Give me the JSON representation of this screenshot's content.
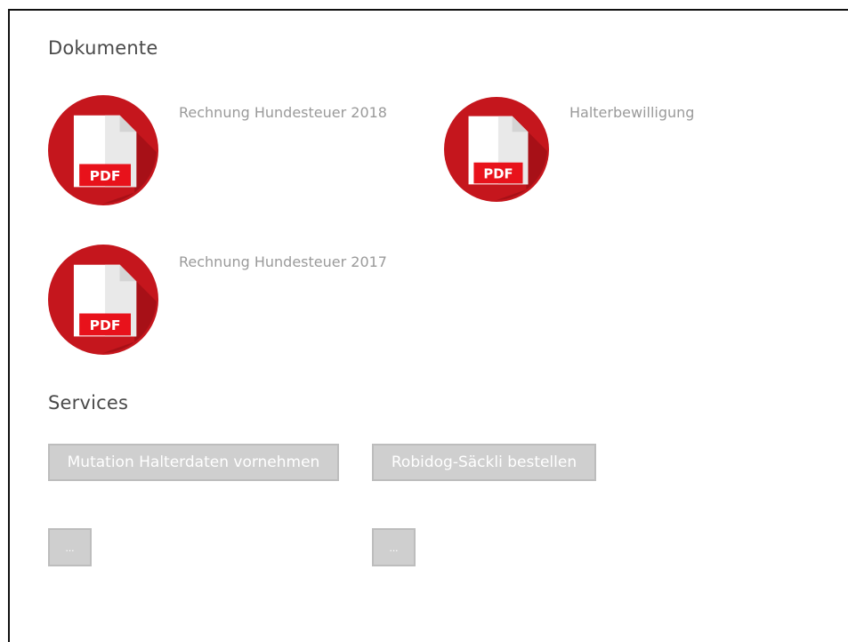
{
  "documents": {
    "heading": "Dokumente",
    "items": [
      {
        "label": "Rechnung Hundesteuer 2018",
        "icon": "pdf-file-icon",
        "icon_text": "PDF"
      },
      {
        "label": "Halterbewilligung",
        "icon": "pdf-file-icon",
        "icon_text": "PDF"
      },
      {
        "label": "Rechnung Hundesteuer 2017",
        "icon": "pdf-file-icon",
        "icon_text": "PDF"
      }
    ]
  },
  "services": {
    "heading": "Services",
    "buttons": [
      {
        "label": "Mutation Halterdaten vornehmen"
      },
      {
        "label": "Robidog-Säckli bestellen"
      },
      {
        "label": "..."
      },
      {
        "label": "..."
      }
    ]
  },
  "colors": {
    "pdf_circle": "#c5161d",
    "pdf_label_bg": "#e8121b",
    "button_bg": "#cfcfcf",
    "button_border": "#bdbdbd"
  }
}
